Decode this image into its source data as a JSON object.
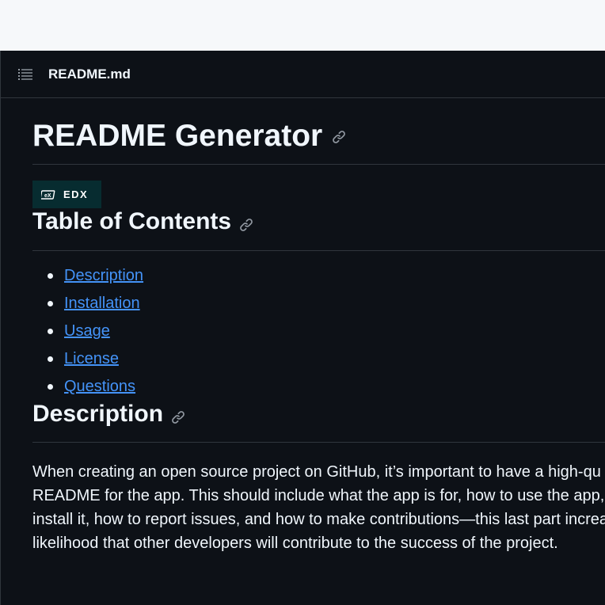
{
  "file": {
    "name": "README.md"
  },
  "readme": {
    "title": "README Generator",
    "badge": {
      "label": "EDX",
      "logo": "edx-logo-icon"
    },
    "toc": {
      "heading": "Table of Contents",
      "items": [
        "Description",
        "Installation",
        "Usage",
        "License",
        "Questions"
      ]
    },
    "description": {
      "heading": "Description",
      "lines": [
        "When creating an open source project on GitHub, it’s important to have a high-qu",
        "README for the app. This should include what the app is for, how to use the app, h",
        "install it, how to report issues, and how to make contributions—this last part increa",
        "likelihood that other developers will contribute to the success of the project."
      ]
    }
  },
  "colors": {
    "background": "#0d1117",
    "text": "#f0f6fc",
    "link": "#4493f8",
    "border": "#30363d",
    "badge_bg": "#072c30"
  }
}
